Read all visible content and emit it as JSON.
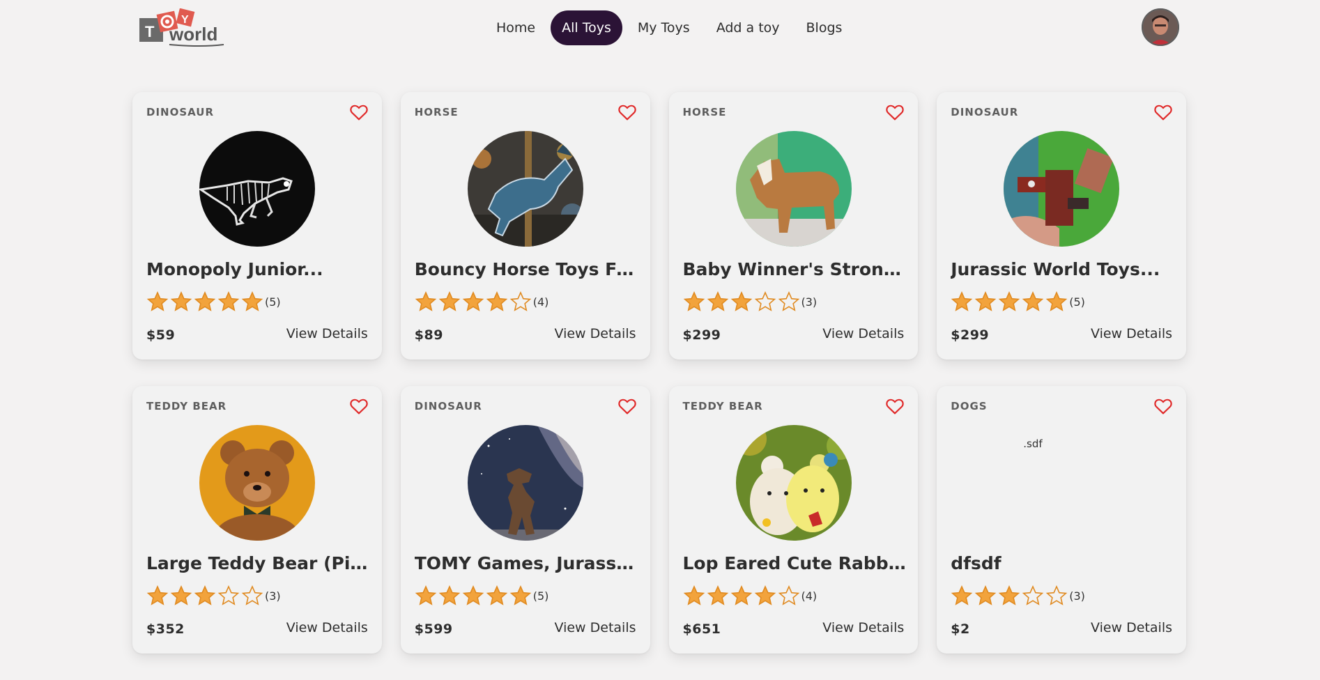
{
  "nav": {
    "logo_text": "TOY world",
    "links": [
      "Home",
      "All Toys",
      "My Toys",
      "Add a toy",
      "Blogs"
    ],
    "active": "All Toys"
  },
  "colors": {
    "accent": "#2b1336",
    "heart": "#e02828",
    "star": "#f2a33c",
    "background": "#f3f2f2"
  },
  "cards": [
    {
      "category": "DINOSAUR",
      "title": "Monopoly Junior...",
      "rating": 5,
      "rating_label": "(5)",
      "price": "$59",
      "action": "View Details",
      "image": "dinosaur-skeleton-photo"
    },
    {
      "category": "HORSE",
      "title": "Bouncy Horse Toys For...",
      "rating": 4,
      "rating_label": "(4)",
      "price": "$89",
      "action": "View Details",
      "image": "carousel-horse-photo"
    },
    {
      "category": "HORSE",
      "title": "Baby Winner's Strong an...",
      "rating": 3,
      "rating_label": "(3)",
      "price": "$299",
      "action": "View Details",
      "image": "wooden-horse-photo"
    },
    {
      "category": "DINOSAUR",
      "title": "Jurassic World Toys...",
      "rating": 5,
      "rating_label": "(5)",
      "price": "$299",
      "action": "View Details",
      "image": "lego-dinosaur-photo"
    },
    {
      "category": "TEDDY BEAR",
      "title": "Large Teddy Bear (Pink)",
      "rating": 3,
      "rating_label": "(3)",
      "price": "$352",
      "action": "View Details",
      "image": "teddy-bear-photo"
    },
    {
      "category": "DINOSAUR",
      "title": "TOMY Games, Jurassic...",
      "rating": 5,
      "rating_label": "(5)",
      "price": "$599",
      "action": "View Details",
      "image": "trex-night-sky-photo"
    },
    {
      "category": "TEDDY BEAR",
      "title": "Lop Eared Cute Rabbit...",
      "rating": 4,
      "rating_label": "(4)",
      "price": "$651",
      "action": "View Details",
      "image": "plush-bears-photo"
    },
    {
      "category": "DOGS",
      "title": "dfsdf",
      "rating": 3,
      "rating_label": "(3)",
      "price": "$2",
      "action": "View Details",
      "image": "broken-image",
      "image_alt": ".sdf"
    }
  ]
}
